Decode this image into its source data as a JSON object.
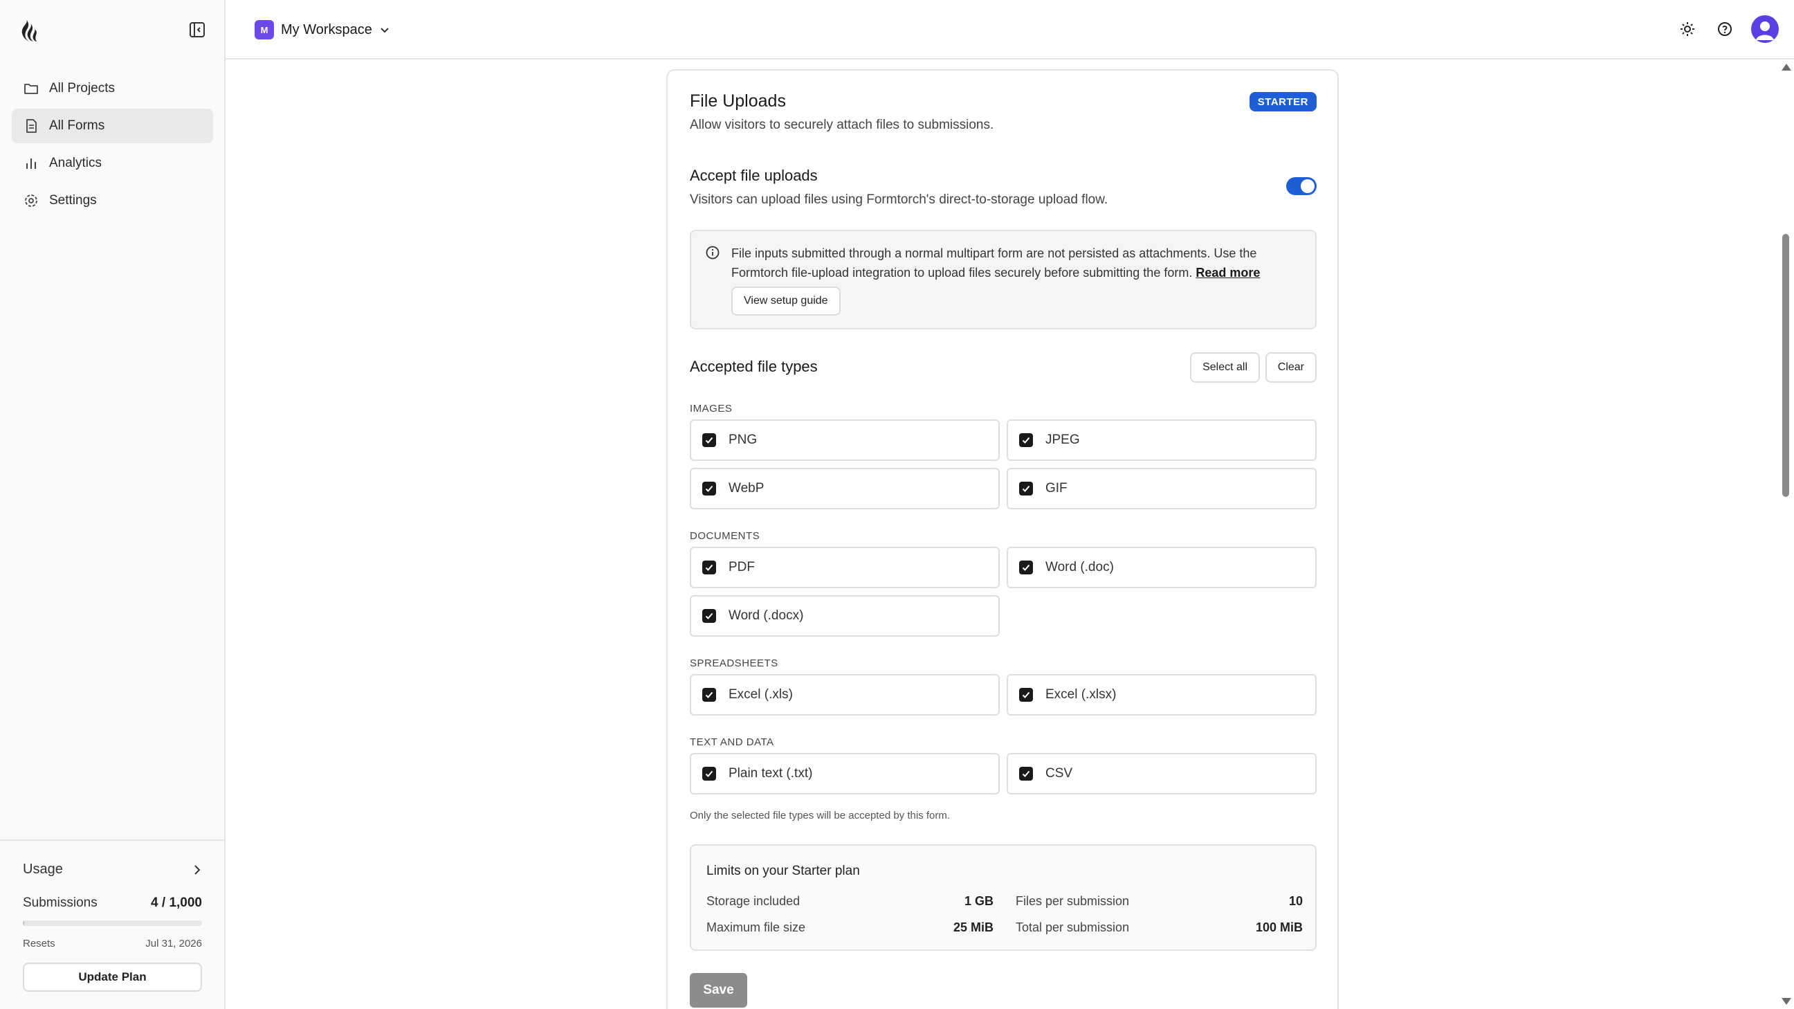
{
  "sidebar": {
    "nav": [
      {
        "label": "All Projects",
        "icon": "folder-icon"
      },
      {
        "label": "All Forms",
        "icon": "form-icon"
      },
      {
        "label": "Analytics",
        "icon": "bar-chart-icon"
      },
      {
        "label": "Settings",
        "icon": "gear-icon"
      }
    ],
    "usage": {
      "label": "Usage",
      "submissions_label": "Submissions",
      "submissions_value": "4 / 1,000",
      "submissions_fraction": 0.004,
      "resets_label": "Resets",
      "resets_date": "Jul 31, 2026",
      "update_button": "Update Plan"
    }
  },
  "topbar": {
    "workspace_initial": "M",
    "workspace_name": "My Workspace"
  },
  "card": {
    "title": "File Uploads",
    "subtitle": "Allow visitors to securely attach files to submissions.",
    "plan_badge": "STARTER",
    "accept_title": "Accept file uploads",
    "accept_desc": "Visitors can upload files using Formtorch's direct-to-storage upload flow.",
    "accept_enabled": true,
    "notice": {
      "text": "File inputs submitted through a normal multipart form are not persisted as attachments. Use the Formtorch file-upload integration to upload files securely before submitting the form.",
      "link": "Read more",
      "button": "View setup guide"
    },
    "types_title": "Accepted file types",
    "select_all": "Select all",
    "clear": "Clear",
    "groups": [
      {
        "label": "IMAGES",
        "items": [
          "PNG",
          "JPEG",
          "WebP",
          "GIF"
        ]
      },
      {
        "label": "DOCUMENTS",
        "items": [
          "PDF",
          "Word (.doc)",
          "Word (.docx)"
        ]
      },
      {
        "label": "SPREADSHEETS",
        "items": [
          "Excel (.xls)",
          "Excel (.xlsx)"
        ]
      },
      {
        "label": "TEXT AND DATA",
        "items": [
          "Plain text (.txt)",
          "CSV"
        ]
      }
    ],
    "footnote": "Only the selected file types will be accepted by this form.",
    "limits": {
      "title": "Limits on your Starter plan",
      "rows": [
        {
          "label": "Storage included",
          "value": "1 GB"
        },
        {
          "label": "Files per submission",
          "value": "10"
        },
        {
          "label": "Maximum file size",
          "value": "25 MiB"
        },
        {
          "label": "Total per submission",
          "value": "100 MiB"
        }
      ]
    },
    "save": "Save"
  },
  "colors": {
    "accent": "#1f5fd6",
    "workspace_badge": "#6d4ae8",
    "avatar": "#5b3fe0"
  }
}
